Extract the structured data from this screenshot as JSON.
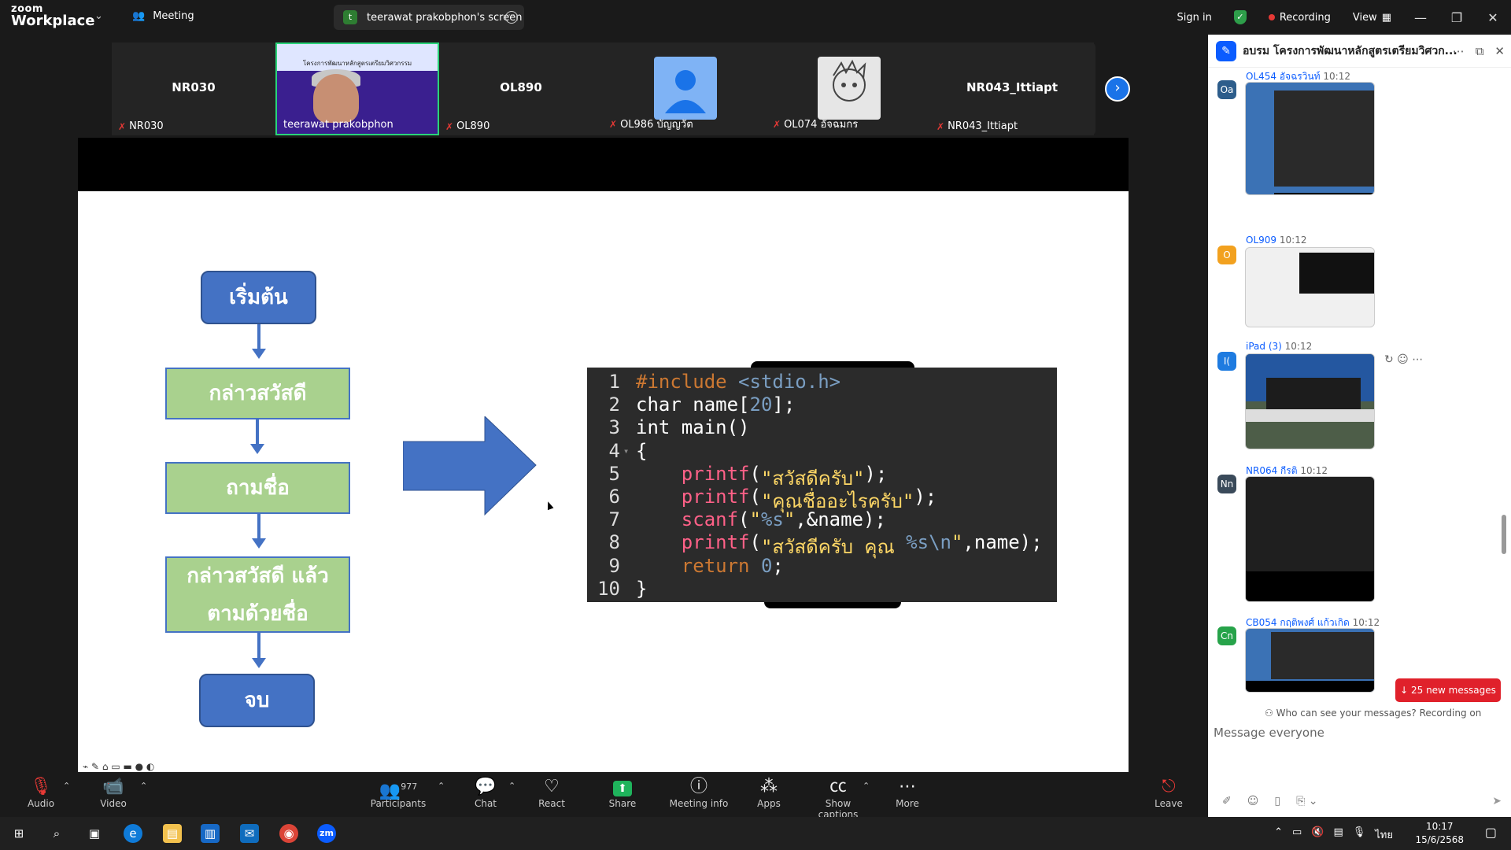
{
  "app": {
    "logo_line1": "zoom",
    "logo_line2": "Workplace",
    "meeting_tab": "Meeting",
    "share_tab": "teerawat prakobphon's screen",
    "share_avatar": "t"
  },
  "title_right": {
    "sign_in": "Sign in",
    "recording": "Recording",
    "view": "View"
  },
  "participants_strip": [
    {
      "name": "NR030",
      "label": "NR030",
      "muted": true
    },
    {
      "name": "",
      "label": "teerawat prakobphon",
      "muted": false,
      "active_speaker": true,
      "video": true
    },
    {
      "name": "OL890",
      "label": "OL890",
      "muted": true
    },
    {
      "name": "",
      "label": "OL986 บัญญวัต",
      "muted": true,
      "avatar": "person-icon"
    },
    {
      "name": "",
      "label": "OL074 อัจฉมกร",
      "muted": true,
      "avatar": "cartoon"
    },
    {
      "name": "NR043_Ittiapt",
      "label": "NR043_Ittiapt",
      "muted": true
    }
  ],
  "thumb_slide_text": "โครงการพัฒนาหลักสูตรเตรียมวิศวกรรม",
  "flowchart": {
    "start": "เริ่มต้น",
    "step1": "กล่าวสวัสดี",
    "step2": "ถามชื่อ",
    "step3_line1": "กล่าวสวัสดี แล้ว",
    "step3_line2": "ตามด้วยชื่อ",
    "end": "จบ"
  },
  "code": {
    "line_numbers": [
      "1",
      "2",
      "3",
      "4",
      "5",
      "6",
      "7",
      "8",
      "9",
      "10"
    ],
    "l1_a": "#include ",
    "l1_b": "<stdio.h>",
    "l2_a": "char name[",
    "l2_b": "20",
    "l2_c": "];",
    "l3": "int main()",
    "l4": "{",
    "l5_a": "    printf",
    "l5_b": "(",
    "l5_c": "\"สวัสดีครับ\"",
    "l5_d": ");",
    "l6_a": "    printf",
    "l6_b": "(",
    "l6_c": "\"คุณชื่ออะไรครับ\"",
    "l6_d": ");",
    "l7_a": "    scanf",
    "l7_b": "(",
    "l7_c": "\"",
    "l7_d": "%s",
    "l7_e": "\"",
    "l7_f": ",&name);",
    "l8_a": "    printf",
    "l8_b": "(",
    "l8_c": "\"สวัสดีครับ คุณ ",
    "l8_d": "%s\\n",
    "l8_e": "\"",
    "l8_f": ",name);",
    "l9_a": "    return ",
    "l9_b": "0",
    "l9_c": ";",
    "l10": "}"
  },
  "toolbar": {
    "audio": "Audio",
    "video": "Video",
    "participants": "Participants",
    "participants_count": "977",
    "chat": "Chat",
    "react": "React",
    "share": "Share",
    "meeting_info": "Meeting info",
    "apps": "Apps",
    "show_captions": "Show captions",
    "more": "More",
    "leave": "Leave"
  },
  "chat": {
    "title": "อบรม โครงการพัฒนาหลักสูตรเตรียมวิศวก...",
    "messages": [
      {
        "avatar": "Oa",
        "name": "OL454 อัจฉรวินท์",
        "time": "10:12",
        "color": "#2d5d8b"
      },
      {
        "avatar": "O",
        "name": "OL909",
        "time": "10:12",
        "color": "#f2a11f"
      },
      {
        "avatar": "I(",
        "name": "iPad (3)",
        "time": "10:12",
        "color": "#1e7be0"
      },
      {
        "avatar": "Nn",
        "name": "NR064 กีรติ",
        "time": "10:12",
        "color": "#3a4a5a"
      },
      {
        "avatar": "Cn",
        "name": "CB054 กฤติพงศ์ แก้วเกิด",
        "time": "10:12",
        "color": "#27a34a"
      }
    ],
    "new_messages": "25 new messages",
    "visibility": "Who can see your messages? Recording on",
    "placeholder": "Message everyone"
  },
  "taskbar": {
    "time": "10:17",
    "date": "15/6/2568",
    "lang": "ไทย"
  }
}
